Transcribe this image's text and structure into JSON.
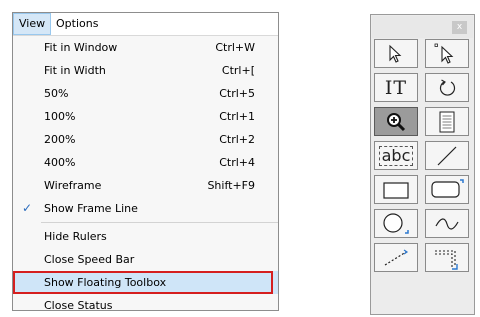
{
  "menubar": {
    "view_label": "View",
    "options_label": "Options"
  },
  "view_menu": {
    "items": [
      {
        "label": "Fit in Window",
        "shortcut": "Ctrl+W"
      },
      {
        "label": "Fit in Width",
        "shortcut": "Ctrl+["
      },
      {
        "label": "50%",
        "shortcut": "Ctrl+5"
      },
      {
        "label": "100%",
        "shortcut": "Ctrl+1"
      },
      {
        "label": "200%",
        "shortcut": "Ctrl+2"
      },
      {
        "label": "400%",
        "shortcut": "Ctrl+4"
      },
      {
        "label": "Wireframe",
        "shortcut": "Shift+F9"
      },
      {
        "label": "Show Frame Line",
        "shortcut": "",
        "checked": true
      },
      {
        "label": "Hide Rulers",
        "shortcut": ""
      },
      {
        "label": "Close Speed Bar",
        "shortcut": ""
      },
      {
        "label": "Show Floating Toolbox",
        "shortcut": "",
        "highlighted": true
      },
      {
        "label": "Close Status",
        "shortcut": ""
      }
    ],
    "check_glyph": "✓"
  },
  "toolbox": {
    "close_glyph": "x",
    "text_tool_label": "IT",
    "label_tool_text": "abc",
    "tools": [
      "select-arrow",
      "multi-select-arrow",
      "text",
      "rotate",
      "zoom",
      "page",
      "label-field",
      "line",
      "rectangle",
      "rounded-rectangle",
      "ellipse",
      "curve",
      "dotted-line",
      "dotted-corner"
    ],
    "pressed_tool": "zoom"
  },
  "colors": {
    "highlight_border": "#d51f1f",
    "highlight_fill": "#cfe5f8",
    "check_color": "#2a6bbd",
    "accent_blue": "#2b78d0"
  }
}
